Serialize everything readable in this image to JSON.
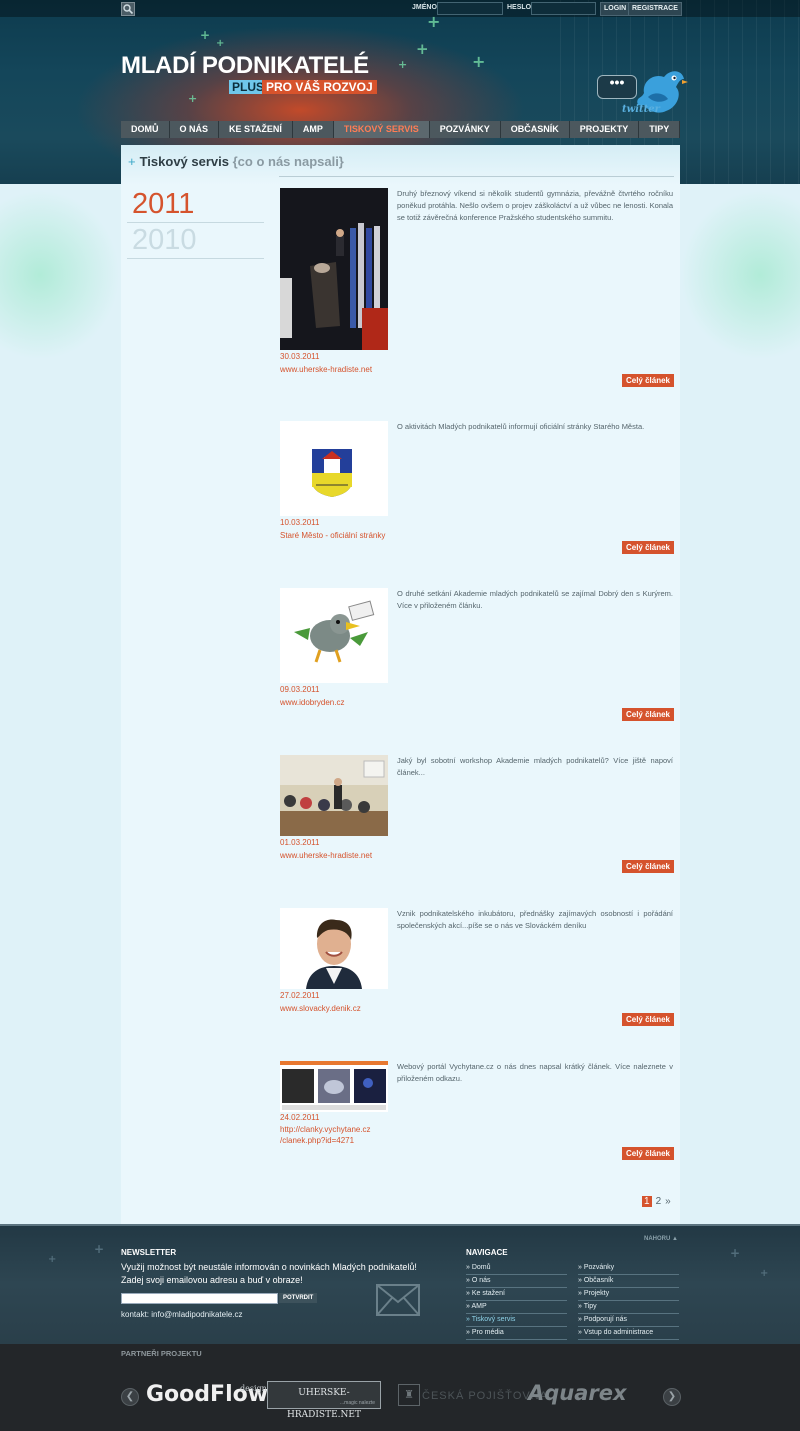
{
  "topbar": {
    "username_label": "JMÉNO",
    "password_label": "HESLO",
    "login_button": "LOGIN",
    "register_button": "REGISTRACE"
  },
  "logo": {
    "title": "MLADÍ PODNIKATELÉ",
    "plus": "PLUS",
    "slogan": "PRO VÁŠ ROZVOJ"
  },
  "twitter": {
    "bubble": "•••",
    "label": "twitter"
  },
  "nav": [
    {
      "label": "DOMŮ"
    },
    {
      "label": "O NÁS"
    },
    {
      "label": "KE STAŽENÍ"
    },
    {
      "label": "AMP"
    },
    {
      "label": "TISKOVÝ SERVIS",
      "active": true
    },
    {
      "label": "POZVÁNKY"
    },
    {
      "label": "OBČASNÍK"
    },
    {
      "label": "PROJEKTY"
    },
    {
      "label": "TIPY"
    }
  ],
  "page": {
    "title": "Tiskový servis",
    "subtitle": "{co o nás napsali}"
  },
  "years": [
    "2011",
    "2010"
  ],
  "articles": [
    {
      "text": "Druhý březnový víkend si několik studentů gymnázia, převážně čtvrtého ročníku poněkud protáhla. Nešlo ovšem o projev záškoláctví a už vůbec ne lenosti. Konala se totiž závěrečná konference Pražského studentského summitu.",
      "date": "30.03.2011",
      "source": "www.uherske-hradiste.net",
      "button": "Celý článek"
    },
    {
      "text": "O aktivitách Mladých podnikatelů informují oficiální stránky Starého Města.",
      "date": "10.03.2011",
      "source": "Staré Město - oficiální stránky",
      "button": "Celý článek"
    },
    {
      "text": "O druhé setkání Akademie mladých podnikatelů se zajímal Dobrý den s Kurýrem. Více v přiloženém článku.",
      "date": "09.03.2011",
      "source": "www.idobryden.cz",
      "button": "Celý článek"
    },
    {
      "text": "Jaký byl sobotní workshop Akademie mladých podnikatelů? Více jiště napoví článek...",
      "date": "01.03.2011",
      "source": "www.uherske-hradiste.net",
      "button": "Celý článek"
    },
    {
      "text": "Vznik podnikatelského inkubátoru, přednášky zajímavých osobností i pořádání společenských akcí...píše se o nás ve Slováckém deníku",
      "date": "27.02.2011",
      "source": "www.slovacky.denik.cz",
      "button": "Celý článek"
    },
    {
      "text": "Webový portál Vychytane.cz o nás dnes napsal krátký článek. Více naleznete v přiloženém odkazu.",
      "date": "24.02.2011",
      "source": "http://clanky.vychytane.cz /clanek.php?id=4271",
      "button": "Celý článek"
    }
  ],
  "pager": {
    "current": "1",
    "next_page": "2",
    "next": "»"
  },
  "footer": {
    "top_link": "NAHORU ▲",
    "newsletter_title": "NEWSLETTER",
    "newsletter_text": "Využij možnost být neustále informován o novinkách Mladých podnikatelů! Zadej svoji emailovou adresu a buď v obraze!",
    "newsletter_button": "POTVRDIT",
    "contact": "kontakt: info@mladipodnikatele.cz",
    "nav_title": "NAVIGACE",
    "nav_col1": [
      "» Domů",
      "» O nás",
      "» Ke stažení",
      "» AMP",
      "» Tiskový servis",
      "» Pro média"
    ],
    "nav_col2": [
      "» Pozvánky",
      "» Občasník",
      "» Projekty",
      "» Tipy",
      "» Podporují nás",
      "» Vstup do administrace"
    ],
    "partners_title": "PARTNEŘI PROJEKTU",
    "partners": {
      "goodflow": "GoodFlow",
      "goodflow_sub": "design",
      "uh": "UHERSKE-HRADISTE.NET",
      "uh_sub": "...magic nalezte",
      "cp": "ČESKÁ POJIŠŤOVNA",
      "aquarex": "Aquarex"
    }
  },
  "colors": {
    "accent": "#d5532d",
    "header_bg": "#14465a",
    "content_bg": "#eaf7fc"
  }
}
